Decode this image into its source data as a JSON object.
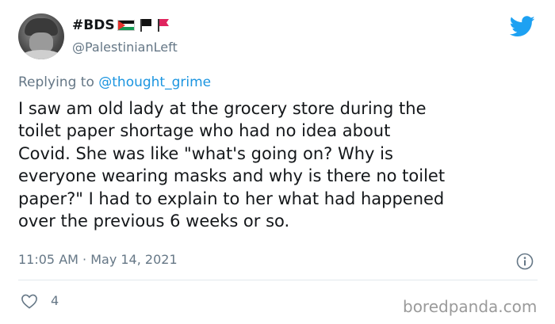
{
  "user": {
    "display_name": "#BDS",
    "handle": "@PalestinianLeft",
    "flags": [
      "palestine-flag-icon",
      "black-flag-icon",
      "red-flag-icon"
    ]
  },
  "reply": {
    "prefix": "Replying to",
    "mention": "@thought_grime"
  },
  "tweet": {
    "lines": [
      "I saw am old lady at the grocery store during the",
      "toilet paper shortage who had no idea about",
      "Covid. She was like \"what's going on? Why is",
      "everyone wearing masks and why is there no toilet",
      "paper?\" I had to explain to her what had happened",
      "over the previous 6 weeks or so."
    ],
    "timestamp": "11:05 AM · May 14, 2021"
  },
  "actions": {
    "likes": "4"
  },
  "watermark": "boredpanda.com",
  "colors": {
    "twitter_blue": "#1da1f2",
    "muted_text": "#657786",
    "mention": "#1b95e0"
  }
}
